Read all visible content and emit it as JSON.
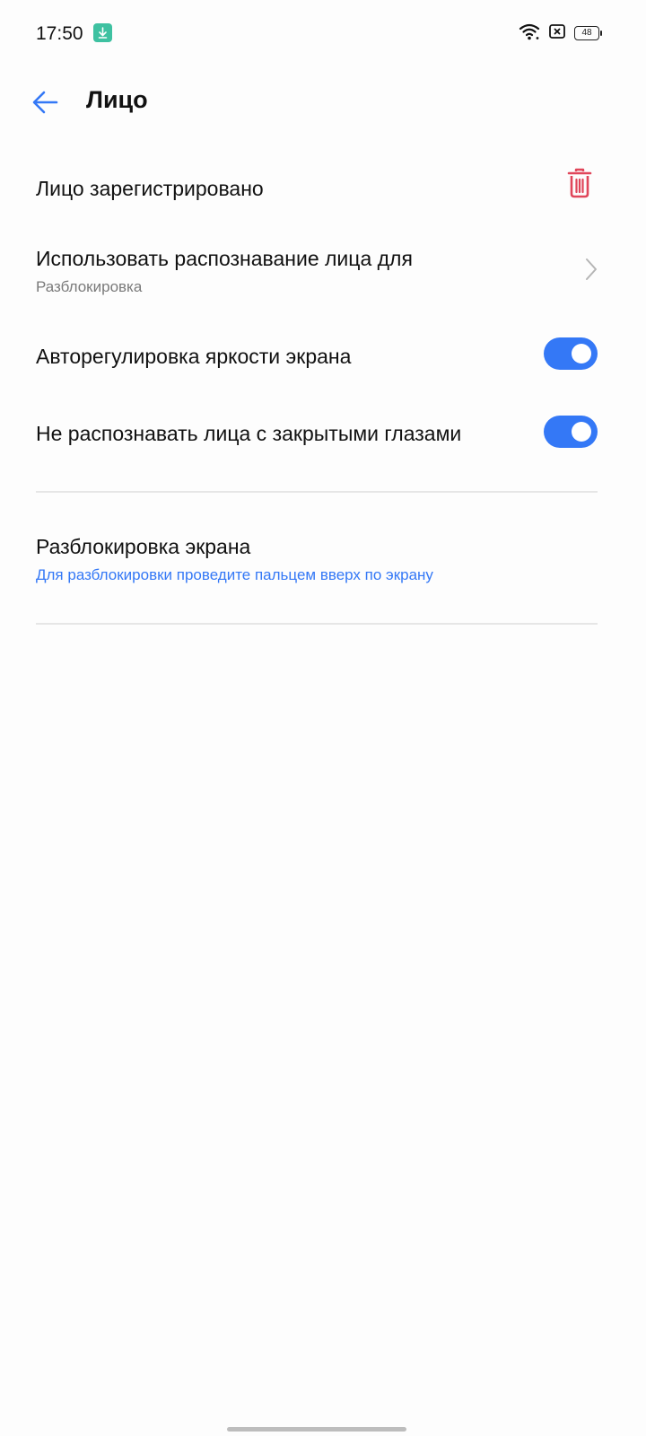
{
  "status_bar": {
    "time": "17:50",
    "download_icon": "download-icon",
    "wifi_icon": "wifi-icon",
    "sim_icon": "sim-icon",
    "battery_level": "48"
  },
  "header": {
    "back_icon": "arrow-left-icon",
    "title": "Лицо"
  },
  "settings": {
    "registered": {
      "title": "Лицо зарегистрировано",
      "icon": "trash-icon",
      "icon_color": "#e0465a"
    },
    "use_for": {
      "title": "Использовать распознавание лица для",
      "subtitle": "Разблокировка",
      "icon": "chevron-right-icon"
    },
    "auto_brightness": {
      "title": "Авторегулировка яркости экрана",
      "enabled": true
    },
    "closed_eyes": {
      "title": "Не распознавать лица с закрытыми глазами",
      "enabled": true
    },
    "screen_unlock": {
      "title": "Разблокировка экрана",
      "subtitle": "Для разблокировки проведите пальцем вверх по экрану"
    }
  },
  "colors": {
    "accent": "#3478f6",
    "danger": "#e0465a",
    "download_badge": "#3ec1a1"
  }
}
